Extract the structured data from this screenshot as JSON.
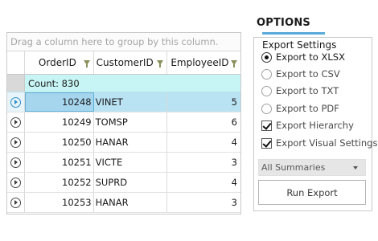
{
  "grid": {
    "group_panel_text": "Drag a column here to group by this column.",
    "columns": [
      "OrderID",
      "CustomerID",
      "EmployeeID"
    ],
    "aggregate_text": "Count: 830",
    "rows": [
      {
        "order_id": "10248",
        "customer_id": "VINET",
        "employee_id": "5"
      },
      {
        "order_id": "10249",
        "customer_id": "TOMSP",
        "employee_id": "6"
      },
      {
        "order_id": "10250",
        "customer_id": "HANAR",
        "employee_id": "4"
      },
      {
        "order_id": "10251",
        "customer_id": "VICTE",
        "employee_id": "3"
      },
      {
        "order_id": "10252",
        "customer_id": "SUPRD",
        "employee_id": "4"
      },
      {
        "order_id": "10253",
        "customer_id": "HANAR",
        "employee_id": "3"
      }
    ],
    "selected_row_index": 0
  },
  "options": {
    "title": "OPTIONS",
    "heading": "Export Settings",
    "formats": [
      {
        "label": "Export to XLSX",
        "checked": true
      },
      {
        "label": "Export to CSV",
        "checked": false
      },
      {
        "label": "Export to TXT",
        "checked": false
      },
      {
        "label": "Export to PDF",
        "checked": false
      }
    ],
    "checkboxes": [
      {
        "label": "Export Hierarchy",
        "checked": true
      },
      {
        "label": "Export Visual Settings",
        "checked": true
      }
    ],
    "summaries_value": "All Summaries",
    "run_button_label": "Run Export"
  },
  "colors": {
    "selected_row": "#b9e2f3",
    "aggregate_row": "#c7f4f4",
    "accent": "#5aa9d9"
  },
  "icons": {
    "row_indicator": "play-circle-icon",
    "column_filter": "filter-icon",
    "dropdown_arrow": "chevron-down-icon"
  }
}
